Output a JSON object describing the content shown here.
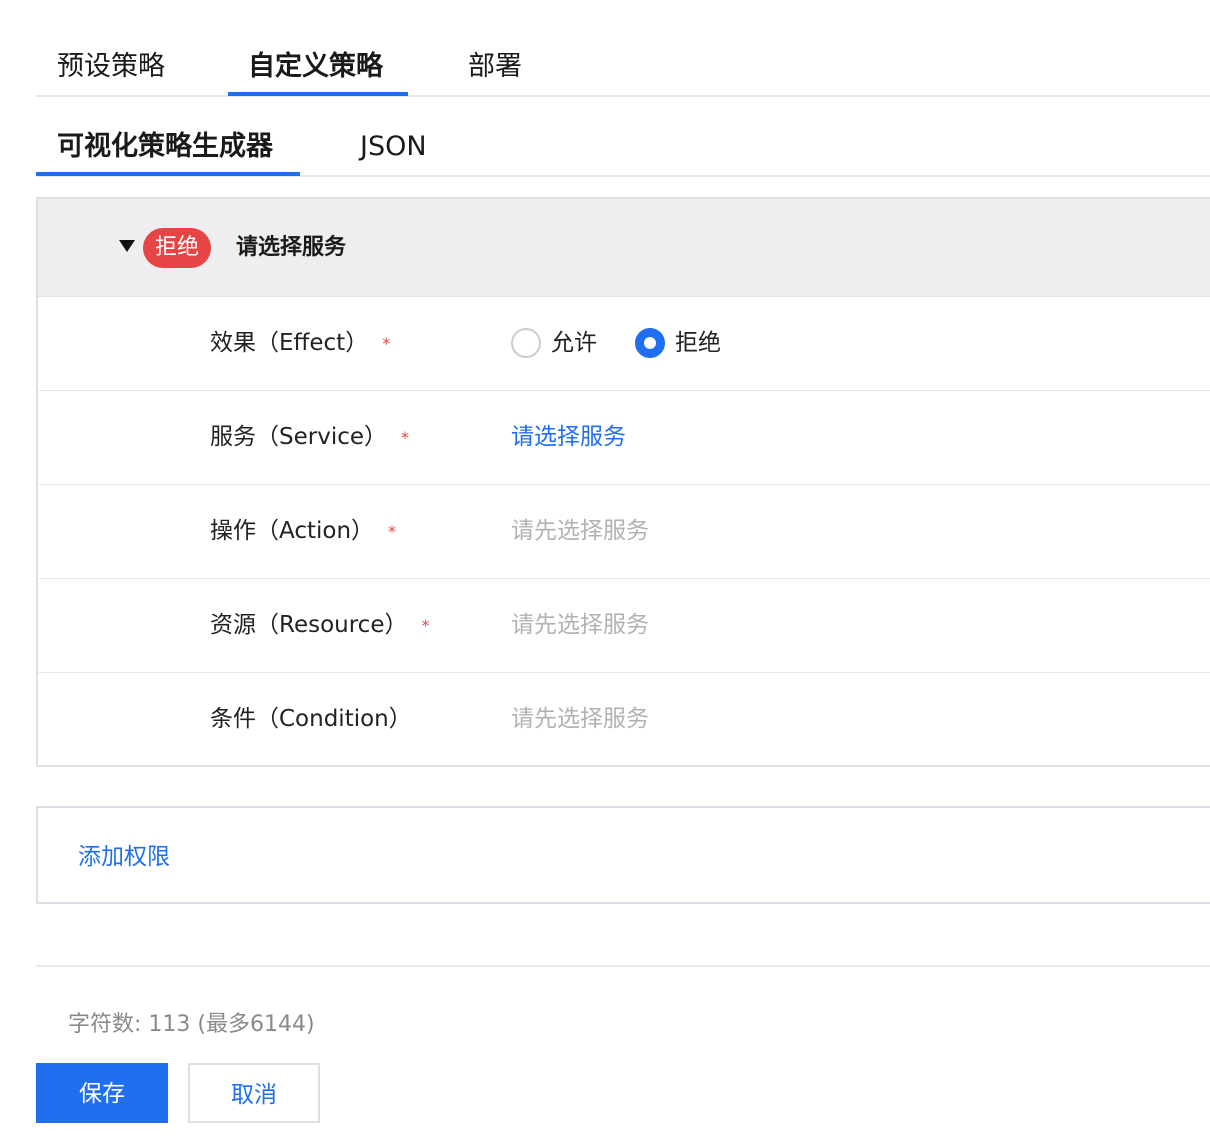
{
  "top_tabs": {
    "preset": "预设策略",
    "custom": "自定义策略",
    "deploy": "部署"
  },
  "sub_tabs": {
    "visual": "可视化策略生成器",
    "json": "JSON"
  },
  "statement": {
    "badge": "拒绝",
    "title": "请选择服务",
    "rows": [
      {
        "label": "效果（Effect）",
        "required": "*"
      },
      {
        "label": "服务（Service）",
        "required": "*",
        "value": "请选择服务"
      },
      {
        "label": "操作（Action）",
        "required": "*",
        "value": "请先选择服务"
      },
      {
        "label": "资源（Resource）",
        "required": "*",
        "value": "请先选择服务"
      },
      {
        "label": "条件（Condition）",
        "value": "请先选择服务"
      }
    ],
    "effect_options": {
      "allow": "允许",
      "deny": "拒绝",
      "selected": "deny"
    }
  },
  "add_permission": "添加权限",
  "char_count": "字符数: 113 (最多6144)",
  "actions": {
    "save": "保存",
    "cancel": "取消"
  },
  "colors": {
    "accent": "#1f6ff0",
    "danger": "#e54545",
    "muted_text": "#b2b2b2"
  }
}
